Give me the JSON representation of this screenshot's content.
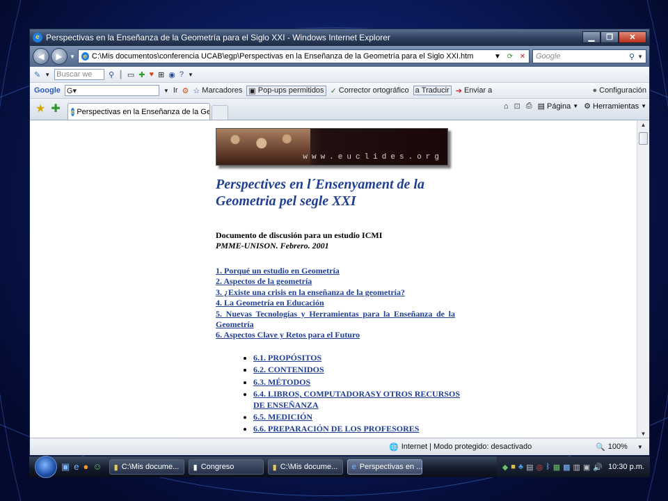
{
  "window": {
    "title": "Perspectivas en la Enseñanza de la Geometría para el Siglo XXI - Windows Internet Explorer",
    "controls": {
      "minimize": "▁",
      "maximize": "❐",
      "close": "✕"
    }
  },
  "address": {
    "url": "C:\\Mis documentos\\conferencia UCAB\\egp\\Perspectivas en la Enseñanza de la Geometría para el Siglo XXI.htm",
    "search_placeholder": "Google"
  },
  "toolbar1": {
    "search_placeholder": "Buscar we"
  },
  "toolbar2": {
    "google_label": "Google",
    "go_label": "Ir",
    "bookmarks": "Marcadores",
    "popups": "Pop-ups permitidos",
    "spell": "Corrector ortográfico",
    "translate": "Traducir",
    "send": "Enviar a",
    "settings": "Configuración"
  },
  "tabs": [
    {
      "label": "Perspectivas en la Enseñanza de la Geo..."
    }
  ],
  "commandbar": {
    "page": "Página",
    "tools": "Herramientas"
  },
  "page": {
    "banner_url": "www.euclides.org",
    "title": "Perspectives en l´Ensenyament de la Geometria pel segle XXI",
    "subtitle": "Documento de discusión para un estudio ICMI",
    "subtitle2": "PMME-UNISON. Febrero. 2001",
    "toc": [
      "1. Porqué un estudio en Geometría",
      "2. Aspectos de la geometría",
      "3. ¿Existe una crisis en la enseñanza de la geometría?",
      "4. La Geometría en Educación",
      "5. Nuevas Tecnologías y Herramientas para la Enseñanza de la Geometría",
      "6. Aspectos Clave y Retos para el Futuro"
    ],
    "subtoc": [
      "6.1. PROPÓSITOS",
      "6.2. CONTENIDOS",
      "6.3. MÉTODOS",
      "6.4. LIBROS, COMPUTADORASY OTROS RECURSOS DE ENSEÑANZA",
      "6.5. MEDICIÓN",
      "6.6. PREPARACIÓN DE LOS PROFESORES"
    ]
  },
  "status": {
    "zone": "Internet | Modo protegido: desactivado",
    "zoom": "100%"
  },
  "taskbar": {
    "tasks": [
      {
        "label": "C:\\Mis docume..."
      },
      {
        "label": "Congreso"
      },
      {
        "label": "C:\\Mis docume..."
      },
      {
        "label": "Perspectivas en ..."
      }
    ],
    "clock": "10:30 p.m."
  }
}
